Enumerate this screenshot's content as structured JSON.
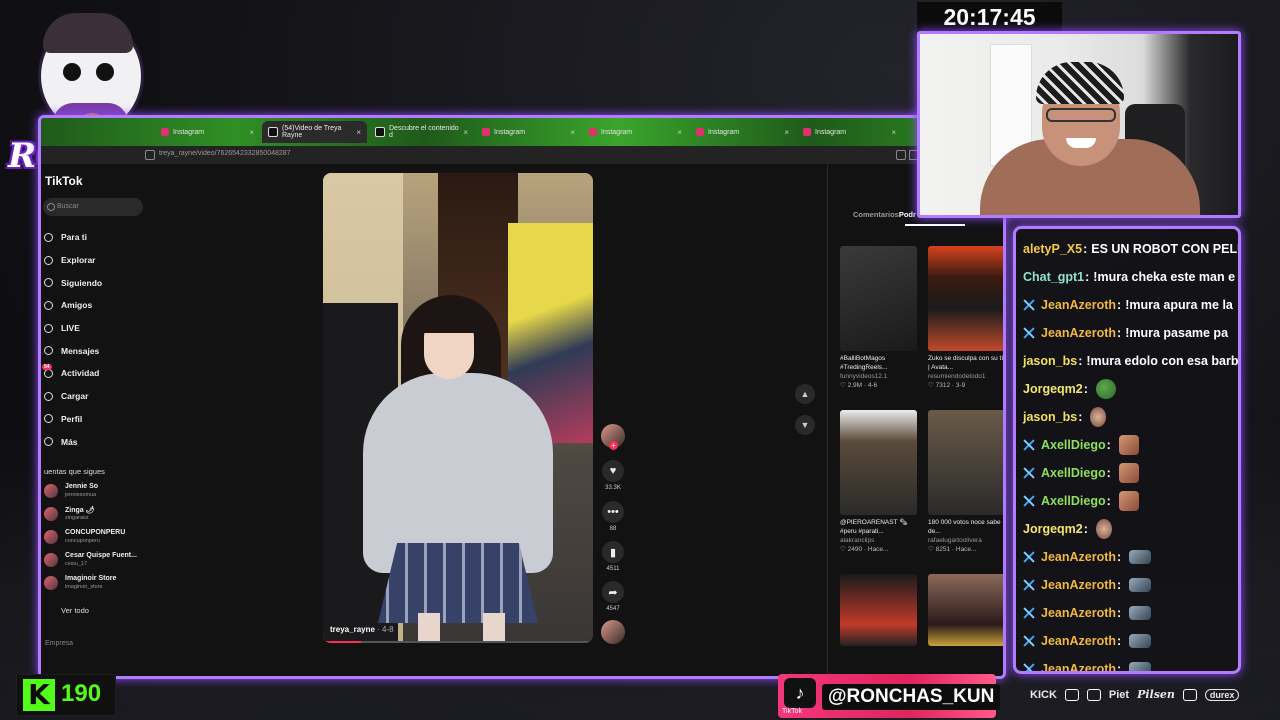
{
  "overlay": {
    "logo_text": "RONCHAS",
    "clock": "20:17:45",
    "kick_count": "190",
    "tiktok_handle": "@RONCHAS_KUN",
    "tiktok_label": "TikTok",
    "sponsors": [
      "KICK",
      "Piet",
      "Pilsen",
      "durex"
    ]
  },
  "browser": {
    "tabs": [
      {
        "label": "Instagram",
        "icon": "instagram-icon",
        "active": false
      },
      {
        "label": "(54)Video de Treya Rayne",
        "icon": "tiktok-icon",
        "active": true
      },
      {
        "label": "Descubre el contenido d",
        "icon": "tiktok-icon",
        "active": false
      },
      {
        "label": "Instagram",
        "icon": "instagram-icon",
        "active": false
      },
      {
        "label": "Instagram",
        "icon": "instagram-icon",
        "active": false
      },
      {
        "label": "Instagram",
        "icon": "instagram-icon",
        "active": false
      },
      {
        "label": "Instagram",
        "icon": "instagram-icon",
        "active": false
      }
    ],
    "url": "treya_rayne/video/7626542332850048287"
  },
  "tiktok": {
    "logo": "TikTok",
    "search_placeholder": "Buscar",
    "nav": [
      {
        "label": "Para ti",
        "icon": "home-icon"
      },
      {
        "label": "Explorar",
        "icon": "compass-icon"
      },
      {
        "label": "Siguiendo",
        "icon": "following-icon"
      },
      {
        "label": "Amigos",
        "icon": "friends-icon"
      },
      {
        "label": "LIVE",
        "icon": "live-icon"
      },
      {
        "label": "Mensajes",
        "icon": "message-icon"
      },
      {
        "label": "Actividad",
        "icon": "activity-icon",
        "badge": "54"
      },
      {
        "label": "Cargar",
        "icon": "upload-icon"
      },
      {
        "label": "Perfil",
        "icon": "profile-icon"
      },
      {
        "label": "Más",
        "icon": "more-icon"
      }
    ],
    "following_header": "uentas que sigues",
    "following": [
      {
        "name": "Jennie So",
        "handle": "jenniesomua"
      },
      {
        "name": "Zinga 🌶",
        "handle": "zingarasz"
      },
      {
        "name": "CONCUPONPERU",
        "handle": "concuponperu"
      },
      {
        "name": "Cesar Quispe Fuent...",
        "handle": "cesiu_17"
      },
      {
        "name": "Imaginoir Store",
        "handle": "imaginoir_store"
      }
    ],
    "ver_todo": "Ver todo",
    "empresa": "Empresa",
    "video": {
      "author": "treya_rayne",
      "age": " · 4-8",
      "progress": 0.14
    },
    "actions": {
      "likes": "33.3K",
      "comments": "88",
      "saves": "4511",
      "shares": "4547"
    },
    "panel_tabs": {
      "comments": "Comentarios",
      "podcasts": "Podr"
    },
    "related": [
      {
        "title": "#BalliBotMagos #TredingReels...",
        "channel": "funnyvideos12.1",
        "stats": "♡ 2.9M · 4-6"
      },
      {
        "title": "Zuko se disculpa con su tío | Avata...",
        "channel": "resumiendodetodo1",
        "stats": "♡ 7312 · 3-9"
      },
      {
        "title": "@PIEROARENAST 🗞 #peru #parati...",
        "channel": "alakranclips",
        "stats": "♡ 2490 · Hace..."
      },
      {
        "title": "180 000 votos noce sabe de...",
        "channel": "rafaelugartoolivera",
        "stats": "♡ 8251 · Hace..."
      }
    ]
  },
  "chat": {
    "messages": [
      {
        "user": "aletyP_X5",
        "color": "#f7c948",
        "text": "ES UN ROBOT CON PELU",
        "badge": false
      },
      {
        "user": "Chat_gpt1",
        "color": "#8fe3c4",
        "text": "!mura cheka este man e",
        "badge": false
      },
      {
        "user": "JeanAzeroth",
        "color": "#f1b93b",
        "text": "!mura apura me la",
        "badge": true
      },
      {
        "user": "JeanAzeroth",
        "color": "#f1b93b",
        "text": "!mura pasame pa",
        "badge": true
      },
      {
        "user": "jason_bs",
        "color": "#f1e05a",
        "text": "!mura edolo con esa barb",
        "badge": false
      },
      {
        "user": "Jorgeqm2",
        "color": "#f3e76a",
        "text": "",
        "badge": false,
        "emote": "pepe"
      },
      {
        "user": "jason_bs",
        "color": "#f1e05a",
        "text": "",
        "badge": false,
        "emote": "face"
      },
      {
        "user": "AxellDiego",
        "color": "#8ee05a",
        "text": "",
        "badge": true,
        "emote": "emo"
      },
      {
        "user": "AxellDiego",
        "color": "#8ee05a",
        "text": "",
        "badge": true,
        "emote": "emo"
      },
      {
        "user": "AxellDiego",
        "color": "#8ee05a",
        "text": "",
        "badge": true,
        "emote": "emo"
      },
      {
        "user": "Jorgeqm2",
        "color": "#f3e76a",
        "text": "",
        "badge": false,
        "emote": "face"
      },
      {
        "user": "JeanAzeroth",
        "color": "#f1b93b",
        "text": "",
        "badge": true,
        "emote": "gun"
      },
      {
        "user": "JeanAzeroth",
        "color": "#f1b93b",
        "text": "",
        "badge": true,
        "emote": "gun"
      },
      {
        "user": "JeanAzeroth",
        "color": "#f1b93b",
        "text": "",
        "badge": true,
        "emote": "gun"
      },
      {
        "user": "JeanAzeroth",
        "color": "#f1b93b",
        "text": "",
        "badge": true,
        "emote": "gun"
      },
      {
        "user": "JeanAzeroth",
        "color": "#f1b93b",
        "text": "",
        "badge": true,
        "emote": "gun"
      }
    ]
  }
}
